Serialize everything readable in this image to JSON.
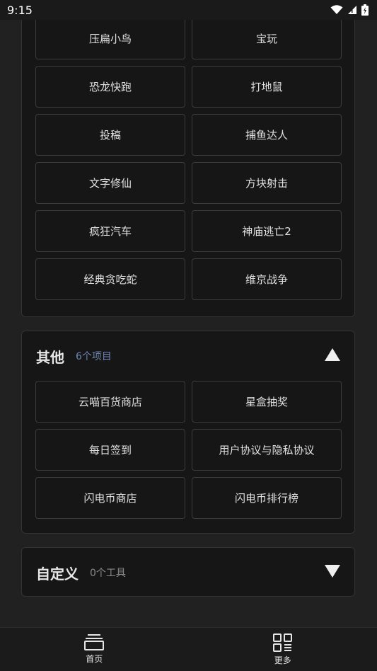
{
  "status_bar": {
    "time": "9:15"
  },
  "games_panel": {
    "items": [
      "压扁小鸟",
      "宝玩",
      "恐龙快跑",
      "打地鼠",
      "投稿",
      "捕鱼达人",
      "文字修仙",
      "方块射击",
      "疯狂汽车",
      "神庙逃亡2",
      "经典贪吃蛇",
      "维京战争"
    ]
  },
  "other_section": {
    "title": "其他",
    "count": "6个项目",
    "count_color": "#6f86b3",
    "expanded": true,
    "items": [
      "云喵百货商店",
      "星盒抽奖",
      "每日签到",
      "用户协议与隐私协议",
      "闪电币商店",
      "闪电币排行榜"
    ]
  },
  "custom_section": {
    "title": "自定义",
    "count": "0个工具",
    "count_color": "#8a8a8a",
    "expanded": false
  },
  "bottom_nav": {
    "home_label": "首页",
    "home_icon": "stack-icon",
    "more_label": "更多",
    "more_icon": "grid-icon"
  }
}
